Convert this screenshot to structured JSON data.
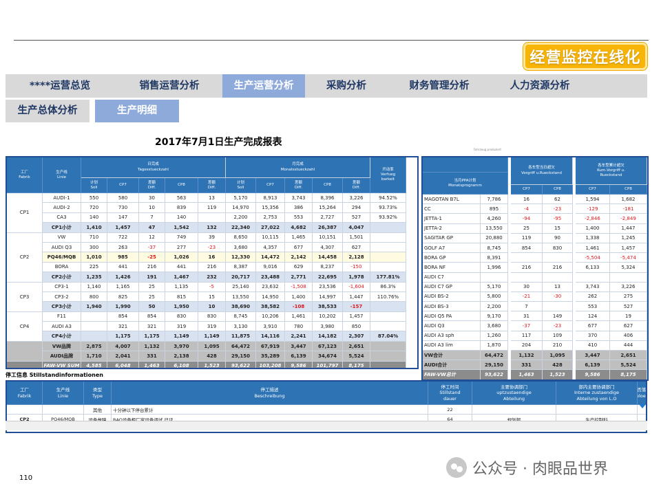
{
  "badge": "经营监控在线化",
  "tabs1": [
    "****运营总览",
    "销售运营分析",
    "生产运营分析",
    "采购分析",
    "财务管理分析",
    "人力资源分析"
  ],
  "tabs2": [
    "生产总体分析",
    "生产明细"
  ],
  "report_title": "2017年7月1日生产完成报表",
  "tiny_note": "Fahrzeug produziert",
  "left": {
    "h_factory": "工厂\nFabrik",
    "h_line": "生产线\nLinie",
    "h_day": "日完成\nTagesstueckzahl",
    "h_month": "月完成\nMonatsstueckzahl",
    "h_avail": "开动率\nVerfueg\nbarkeit",
    "h_plan": "计划\nSoll",
    "h_cp7": "CP7",
    "h_diff": "差额\nDiff.",
    "h_cp8": "CP8",
    "rows": [
      [
        "CP1",
        "AUDI-1",
        "550",
        "580",
        "30",
        "563",
        "13",
        "5,170",
        "8,913",
        "3,743",
        "8,396",
        "3,226",
        "94.52%"
      ],
      [
        "",
        "AUDI-2",
        "720",
        "730",
        "10",
        "839",
        "119",
        "14,970",
        "15,356",
        "386",
        "15,264",
        "294",
        "93.73%"
      ],
      [
        "",
        "CA3",
        "140",
        "147",
        "7",
        "140",
        "",
        "2,200",
        "2,753",
        "553",
        "2,727",
        "527",
        "93.92%"
      ],
      [
        "",
        "CP1小计",
        "1,410",
        "1,457",
        "47",
        "1,542",
        "132",
        "22,340",
        "27,022",
        "4,682",
        "26,387",
        "4,047",
        ""
      ],
      [
        "CP2",
        "VW",
        "710",
        "722",
        "12",
        "749",
        "39",
        "8,650",
        "10,115",
        "1,465",
        "10,151",
        "1,501",
        ""
      ],
      [
        "",
        "AUDI Q3",
        "300",
        "263",
        "-37",
        "277",
        "-23",
        "3,680",
        "4,357",
        "677",
        "4,307",
        "627",
        ""
      ],
      [
        "",
        "PQ46/MQB",
        "1,010",
        "985",
        "-25",
        "1,026",
        "16",
        "12,330",
        "14,472",
        "2,142",
        "14,458",
        "2,128",
        ""
      ],
      [
        "",
        "BORA",
        "225",
        "441",
        "216",
        "441",
        "216",
        "8,387",
        "9,016",
        "629",
        "8,237",
        "-150",
        ""
      ],
      [
        "",
        "CP2小计",
        "1,235",
        "1,426",
        "191",
        "1,467",
        "232",
        "20,717",
        "23,488",
        "2,771",
        "22,695",
        "1,978",
        "177.81%"
      ],
      [
        "CP3",
        "CP3-1",
        "1,140",
        "1,165",
        "25",
        "1,135",
        "-5",
        "25,140",
        "23,632",
        "-1,508",
        "23,536",
        "-1,604",
        "86.3%"
      ],
      [
        "",
        "CP3-2",
        "800",
        "825",
        "25",
        "815",
        "15",
        "13,550",
        "14,950",
        "1,400",
        "14,997",
        "1,447",
        "110.76%"
      ],
      [
        "",
        "CP3小计",
        "1,940",
        "1,990",
        "50",
        "1,950",
        "10",
        "38,690",
        "38,582",
        "-108",
        "38,533",
        "-157",
        ""
      ],
      [
        "CP4",
        "F11",
        "",
        "854",
        "854",
        "830",
        "830",
        "8,745",
        "10,206",
        "1,461",
        "10,202",
        "1,457",
        ""
      ],
      [
        "",
        "AUDI A3",
        "",
        "321",
        "321",
        "319",
        "319",
        "3,130",
        "3,910",
        "780",
        "3,980",
        "850",
        ""
      ],
      [
        "",
        "CP4小计",
        "",
        "1,175",
        "1,175",
        "1,149",
        "1,149",
        "11,875",
        "14,116",
        "2,241",
        "14,182",
        "2,307",
        "87.04%"
      ],
      [
        "",
        "VW品牌",
        "2,875",
        "4,007",
        "1,132",
        "3,970",
        "1,095",
        "64,472",
        "67,919",
        "3,447",
        "67,123",
        "2,651",
        ""
      ],
      [
        "",
        "AUDI品牌",
        "1,710",
        "2,041",
        "331",
        "2,138",
        "428",
        "29,150",
        "35,289",
        "6,139",
        "34,674",
        "5,524",
        ""
      ],
      [
        "",
        "FAW-VW SUM",
        "4,585",
        "6,048",
        "1,463",
        "6,108",
        "1,523",
        "93,622",
        "103,208",
        "9,586",
        "101,797",
        "8,175",
        ""
      ]
    ]
  },
  "right": {
    "h_ppa": "当月PPA计划\nMonatsprogramm",
    "h_acc": "各车型当日超欠\nVorgriff u.Rueckstand",
    "h_cum": "各车型累计超欠\nKum.Vorgriff u.\nRueckstand",
    "h_cp7": "CP7",
    "h_cp8": "CP8",
    "rows": [
      [
        "MAGOTAN B7L",
        "7,786",
        "16",
        "62",
        "1,594",
        "1,682"
      ],
      [
        "CC",
        "895",
        "-4",
        "-23",
        "-129",
        "-181"
      ],
      [
        "JETTA-1",
        "4,260",
        "-94",
        "-95",
        "-2,846",
        "-2,849"
      ],
      [
        "JETTA-2",
        "13,550",
        "25",
        "15",
        "1,400",
        "1,447"
      ],
      [
        "SAGITAR GP",
        "20,880",
        "119",
        "90",
        "1,338",
        "1,245"
      ],
      [
        "GOLF A7",
        "8,745",
        "854",
        "830",
        "1,461",
        "1,457"
      ],
      [
        "BORA GP",
        "8,391",
        "",
        "",
        "-5,504",
        "-5,474"
      ],
      [
        "BORA NF",
        "1,996",
        "216",
        "216",
        "6,133",
        "5,324"
      ],
      [
        "AUDI C7",
        "",
        "",
        "",
        "",
        ""
      ],
      [
        "AUDI C7 GP",
        "5,170",
        "30",
        "13",
        "3,743",
        "3,226"
      ],
      [
        "AUDI BS-2",
        "5,800",
        "-21",
        "-30",
        "262",
        "275"
      ],
      [
        "AUDI BS-3",
        "2,200",
        "7",
        "",
        "553",
        "527"
      ],
      [
        "AUDI Q5 PA",
        "9,170",
        "31",
        "149",
        "124",
        "19"
      ],
      [
        "AUDI Q3",
        "3,680",
        "-37",
        "-23",
        "677",
        "627"
      ],
      [
        "AUDI A3 sph",
        "1,260",
        "117",
        "109",
        "370",
        "406"
      ],
      [
        "AUDI A3 lim",
        "1,870",
        "204",
        "210",
        "410",
        "444"
      ],
      [
        "VW合计",
        "64,472",
        "1,132",
        "1,095",
        "3,447",
        "2,651"
      ],
      [
        "AUDI合计",
        "29,150",
        "331",
        "428",
        "6,139",
        "5,524"
      ],
      [
        "FAW-VW总计",
        "93,622",
        "1,463",
        "1,523",
        "9,586",
        "8,175"
      ]
    ]
  },
  "stop": {
    "title": "停工信息 Stillstandinformationen",
    "headers": [
      "工厂\nFabrik",
      "生产线\nLinie",
      "类型\nType",
      "停工描述\nBeschreibung",
      "停工时间\nStillstand\ndauer",
      "主要协调部门\nuptzustaendige\nAbteilung",
      "部内主要协调部门\nInterne zustaendige\nAbteilung von L.O",
      "是否落实?\ngeloest?"
    ],
    "rows": [
      [
        "",
        "",
        "其他",
        "十分钟以下停台累计",
        "22",
        "",
        "",
        ""
      ],
      [
        "CP2",
        "PQ46/MQB",
        "设备故障",
        "BAO设备柜厂家设备调试 已证",
        "64",
        "规划部",
        "生产控制科",
        ""
      ]
    ]
  },
  "page_number": "110",
  "watermark": "公众号 · 肉眼品世界"
}
